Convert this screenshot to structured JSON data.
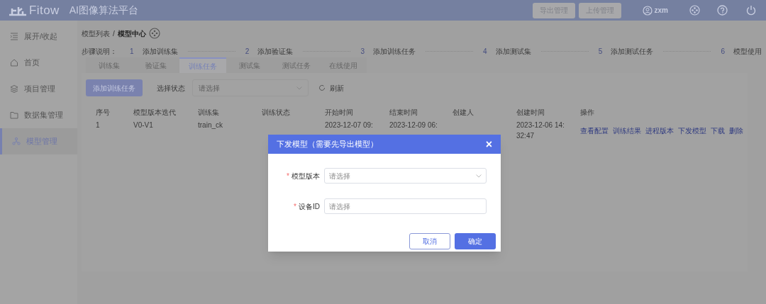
{
  "header": {
    "logo": "Fitow",
    "title": "AI图像算法平台",
    "buttons": [
      "导出管理",
      "上传管理"
    ],
    "user": "zxm"
  },
  "sidebar": {
    "items": [
      {
        "label": "展开/收起",
        "kind": "toggle",
        "selected": false
      },
      {
        "label": "首页",
        "kind": "home",
        "selected": false
      },
      {
        "label": "项目管理",
        "kind": "layers",
        "selected": false
      },
      {
        "label": "数据集管理",
        "kind": "folder",
        "selected": false
      },
      {
        "label": "模型管理",
        "kind": "model",
        "selected": true
      }
    ]
  },
  "breadcrumb": {
    "items": [
      "模型列表",
      "模型中心"
    ],
    "separator": "/"
  },
  "steps": {
    "label": "步骤说明：",
    "items": [
      {
        "number": "1",
        "label": "添加训练集"
      },
      {
        "number": "2",
        "label": "添加验证集"
      },
      {
        "number": "3",
        "label": "添加训练任务"
      },
      {
        "number": "4",
        "label": "添加测试集"
      },
      {
        "number": "5",
        "label": "添加测试任务"
      },
      {
        "number": "6",
        "label": "模型使用"
      }
    ]
  },
  "tabs": [
    {
      "label": "训练集",
      "selected": false
    },
    {
      "label": "验证集",
      "selected": false
    },
    {
      "label": "训练任务",
      "selected": true
    },
    {
      "label": "测试集",
      "selected": false
    },
    {
      "label": "测试任务",
      "selected": false
    },
    {
      "label": "在线使用",
      "selected": false
    }
  ],
  "toolbar": {
    "add_button": "添加训练任务",
    "filter_label": "选择状态",
    "filter_placeholder": "请选择",
    "refresh": "刷新"
  },
  "table": {
    "columns": [
      "序号",
      "模型版本迭代",
      "训练集",
      "训练状态",
      "开始时间",
      "结束时间",
      "创建人",
      "创建时间",
      "操作"
    ],
    "rows": [
      {
        "index": "1",
        "version": "V0-V1",
        "train_set": "train_ck",
        "start_time": "2023-12-07 09:",
        "end_time": "2023-12-09 06:",
        "created_at": "2023-12-06 14:\n32:47",
        "actions": [
          "查看配置",
          "训练结果",
          "进程版本",
          "下发模型",
          "下载",
          "删除"
        ]
      }
    ]
  },
  "modal": {
    "title": "下发模型（需要先导出模型）",
    "close": "×",
    "fields": [
      {
        "label": "模型版本",
        "required_mark": "*",
        "kind": "select",
        "placeholder": "请选择"
      },
      {
        "label": "设备ID",
        "required_mark": "*",
        "kind": "input",
        "placeholder": "请选择"
      }
    ],
    "buttons": [
      {
        "label": "取消",
        "kind": "secondary"
      },
      {
        "label": "确定",
        "kind": "primary"
      }
    ]
  }
}
